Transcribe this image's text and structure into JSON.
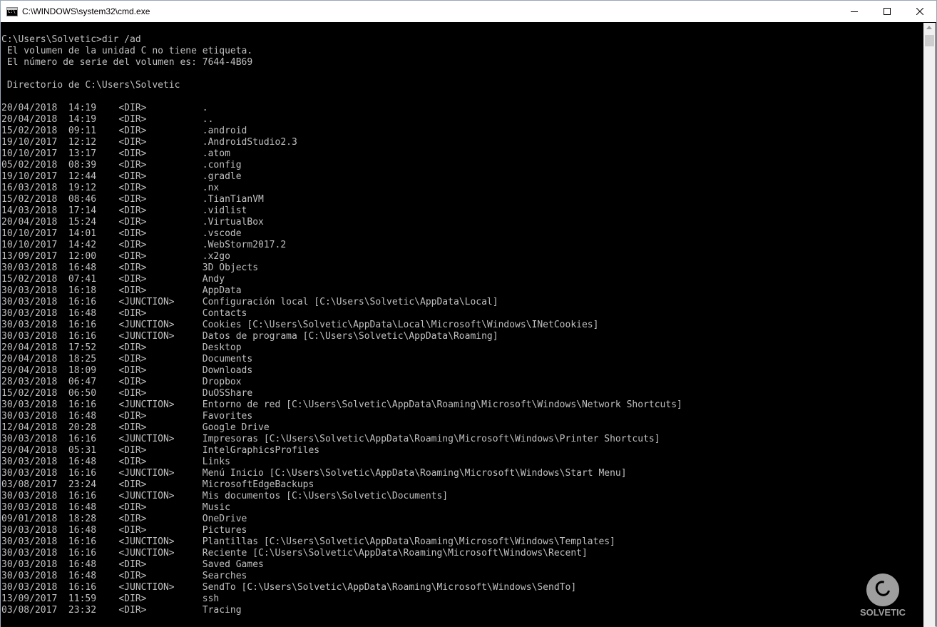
{
  "window": {
    "title": "C:\\WINDOWS\\system32\\cmd.exe",
    "controls": {
      "minimize": "minimize-icon",
      "maximize": "maximize-icon",
      "close": "close-icon"
    }
  },
  "console": {
    "lines": [
      "C:\\Users\\Solvetic>dir /ad",
      " El volumen de la unidad C no tiene etiqueta.",
      " El número de serie del volumen es: 7644-4B69",
      "",
      " Directorio de C:\\Users\\Solvetic",
      "",
      "20/04/2018  14:19    <DIR>          .",
      "20/04/2018  14:19    <DIR>          ..",
      "15/02/2018  09:11    <DIR>          .android",
      "19/10/2017  12:12    <DIR>          .AndroidStudio2.3",
      "10/10/2017  13:17    <DIR>          .atom",
      "05/02/2018  08:39    <DIR>          .config",
      "19/10/2017  12:44    <DIR>          .gradle",
      "16/03/2018  19:12    <DIR>          .nx",
      "15/02/2018  08:46    <DIR>          .TianTianVM",
      "14/03/2018  17:14    <DIR>          .vidlist",
      "20/04/2018  15:24    <DIR>          .VirtualBox",
      "10/10/2017  14:01    <DIR>          .vscode",
      "10/10/2017  14:42    <DIR>          .WebStorm2017.2",
      "13/09/2017  12:00    <DIR>          .x2go",
      "30/03/2018  16:48    <DIR>          3D Objects",
      "15/02/2018  07:41    <DIR>          Andy",
      "30/03/2018  16:18    <DIR>          AppData",
      "30/03/2018  16:16    <JUNCTION>     Configuración local [C:\\Users\\Solvetic\\AppData\\Local]",
      "30/03/2018  16:48    <DIR>          Contacts",
      "30/03/2018  16:16    <JUNCTION>     Cookies [C:\\Users\\Solvetic\\AppData\\Local\\Microsoft\\Windows\\INetCookies]",
      "30/03/2018  16:16    <JUNCTION>     Datos de programa [C:\\Users\\Solvetic\\AppData\\Roaming]",
      "20/04/2018  17:52    <DIR>          Desktop",
      "20/04/2018  18:25    <DIR>          Documents",
      "20/04/2018  18:09    <DIR>          Downloads",
      "28/03/2018  06:47    <DIR>          Dropbox",
      "15/02/2018  06:50    <DIR>          DuOSShare",
      "30/03/2018  16:16    <JUNCTION>     Entorno de red [C:\\Users\\Solvetic\\AppData\\Roaming\\Microsoft\\Windows\\Network Shortcuts]",
      "30/03/2018  16:48    <DIR>          Favorites",
      "12/04/2018  20:28    <DIR>          Google Drive",
      "30/03/2018  16:16    <JUNCTION>     Impresoras [C:\\Users\\Solvetic\\AppData\\Roaming\\Microsoft\\Windows\\Printer Shortcuts]",
      "20/04/2018  05:31    <DIR>          IntelGraphicsProfiles",
      "30/03/2018  16:48    <DIR>          Links",
      "30/03/2018  16:16    <JUNCTION>     Menú Inicio [C:\\Users\\Solvetic\\AppData\\Roaming\\Microsoft\\Windows\\Start Menu]",
      "03/08/2017  23:24    <DIR>          MicrosoftEdgeBackups",
      "30/03/2018  16:16    <JUNCTION>     Mis documentos [C:\\Users\\Solvetic\\Documents]",
      "30/03/2018  16:48    <DIR>          Music",
      "09/01/2018  18:28    <DIR>          OneDrive",
      "30/03/2018  16:48    <DIR>          Pictures",
      "30/03/2018  16:16    <JUNCTION>     Plantillas [C:\\Users\\Solvetic\\AppData\\Roaming\\Microsoft\\Windows\\Templates]",
      "30/03/2018  16:16    <JUNCTION>     Reciente [C:\\Users\\Solvetic\\AppData\\Roaming\\Microsoft\\Windows\\Recent]",
      "30/03/2018  16:48    <DIR>          Saved Games",
      "30/03/2018  16:48    <DIR>          Searches",
      "30/03/2018  16:16    <JUNCTION>     SendTo [C:\\Users\\Solvetic\\AppData\\Roaming\\Microsoft\\Windows\\SendTo]",
      "13/09/2017  11:59    <DIR>          ssh",
      "03/08/2017  23:32    <DIR>          Tracing"
    ]
  },
  "watermark": {
    "text": "SOLVETIC"
  },
  "colors": {
    "console_bg": "#000000",
    "console_fg": "#c0c0c0",
    "titlebar_bg": "#ffffff"
  }
}
